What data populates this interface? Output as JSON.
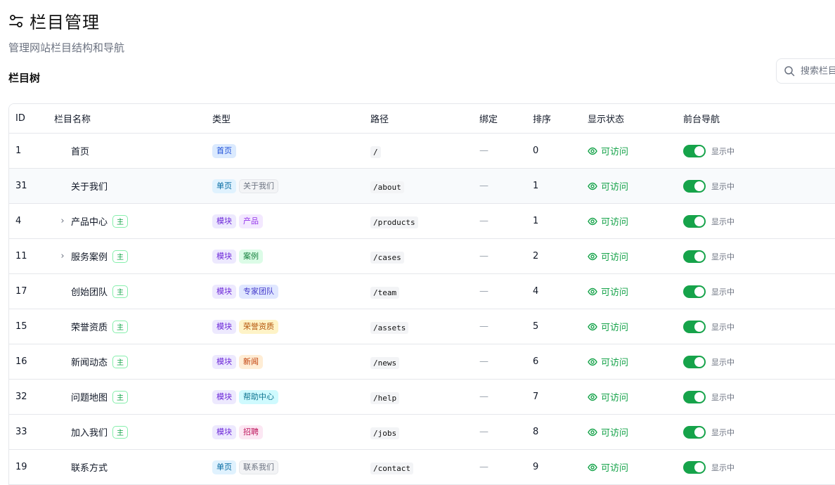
{
  "page": {
    "title": "栏目管理",
    "subtitle": "管理网站栏目结构和导航",
    "section_title": "栏目树",
    "search_placeholder": "搜索栏目"
  },
  "table": {
    "headers": [
      "ID",
      "栏目名称",
      "类型",
      "路径",
      "绑定",
      "排序",
      "显示状态",
      "前台导航"
    ],
    "rows": [
      {
        "id": "1",
        "name": "首页",
        "expandable": false,
        "main": false,
        "type": "首页",
        "type_color": "blue",
        "sub": "",
        "sub_color": "",
        "path": "/",
        "bind": "—",
        "order": "0",
        "visibility": "可访问",
        "nav": "显示中"
      },
      {
        "id": "31",
        "name": "关于我们",
        "expandable": false,
        "main": false,
        "type": "单页",
        "type_color": "sky",
        "sub": "关于我们",
        "sub_color": "gray",
        "path": "/about",
        "bind": "—",
        "order": "1",
        "visibility": "可访问",
        "nav": "显示中"
      },
      {
        "id": "4",
        "name": "产品中心",
        "expandable": true,
        "main": true,
        "type": "模块",
        "type_color": "purple",
        "sub": "产品",
        "sub_color": "fuchsia",
        "path": "/products",
        "bind": "—",
        "order": "1",
        "visibility": "可访问",
        "nav": "显示中"
      },
      {
        "id": "11",
        "name": "服务案例",
        "expandable": true,
        "main": true,
        "type": "模块",
        "type_color": "purple",
        "sub": "案例",
        "sub_color": "green",
        "path": "/cases",
        "bind": "—",
        "order": "2",
        "visibility": "可访问",
        "nav": "显示中"
      },
      {
        "id": "17",
        "name": "创始团队",
        "expandable": false,
        "main": true,
        "type": "模块",
        "type_color": "purple",
        "sub": "专家团队",
        "sub_color": "indigo",
        "path": "/team",
        "bind": "—",
        "order": "4",
        "visibility": "可访问",
        "nav": "显示中"
      },
      {
        "id": "15",
        "name": "荣誉资质",
        "expandable": false,
        "main": true,
        "type": "模块",
        "type_color": "purple",
        "sub": "荣誉资质",
        "sub_color": "amber",
        "path": "/assets",
        "bind": "—",
        "order": "5",
        "visibility": "可访问",
        "nav": "显示中"
      },
      {
        "id": "16",
        "name": "新闻动态",
        "expandable": false,
        "main": true,
        "type": "模块",
        "type_color": "purple",
        "sub": "新闻",
        "sub_color": "orange",
        "path": "/news",
        "bind": "—",
        "order": "6",
        "visibility": "可访问",
        "nav": "显示中"
      },
      {
        "id": "32",
        "name": "问题地图",
        "expandable": false,
        "main": true,
        "type": "模块",
        "type_color": "purple",
        "sub": "帮助中心",
        "sub_color": "cyan",
        "path": "/help",
        "bind": "—",
        "order": "7",
        "visibility": "可访问",
        "nav": "显示中"
      },
      {
        "id": "33",
        "name": "加入我们",
        "expandable": false,
        "main": true,
        "type": "模块",
        "type_color": "purple",
        "sub": "招聘",
        "sub_color": "pink",
        "path": "/jobs",
        "bind": "—",
        "order": "8",
        "visibility": "可访问",
        "nav": "显示中"
      },
      {
        "id": "19",
        "name": "联系方式",
        "expandable": false,
        "main": false,
        "type": "单页",
        "type_color": "sky",
        "sub": "联系我们",
        "sub_color": "gray",
        "path": "/contact",
        "bind": "—",
        "order": "9",
        "visibility": "可访问",
        "nav": "显示中"
      }
    ],
    "main_badge": "主"
  }
}
